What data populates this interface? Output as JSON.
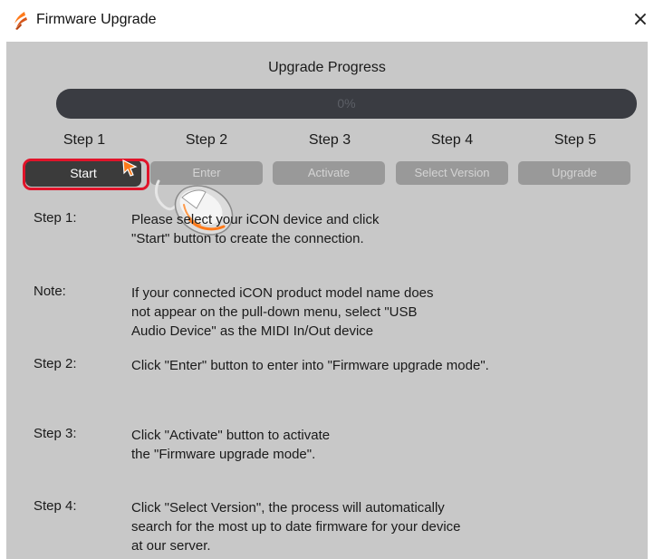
{
  "window": {
    "title": "Firmware Upgrade",
    "app_icon": "orange-swoosh-icon",
    "close_symbol": "×",
    "close_icon": "close-icon"
  },
  "progress": {
    "heading": "Upgrade Progress",
    "percent_label": "0%",
    "value": 0
  },
  "steps": [
    {
      "label": "Step 1",
      "button": "Start",
      "state": "active"
    },
    {
      "label": "Step 2",
      "button": "Enter",
      "state": "disabled"
    },
    {
      "label": "Step 3",
      "button": "Activate",
      "state": "disabled"
    },
    {
      "label": "Step 4",
      "button": "Select Version",
      "state": "disabled"
    },
    {
      "label": "Step 5",
      "button": "Upgrade",
      "state": "disabled"
    }
  ],
  "instructions": [
    {
      "label": "Step 1:",
      "text": "Please select your iCON device and click\n\"Start\" button to create the connection."
    },
    {
      "label": "Note:",
      "text": "If your connected iCON product model name does\nnot appear on the pull-down menu, select \"USB\nAudio Device\" as the MIDI In/Out device"
    },
    {
      "label": "Step 2:",
      "text": "Click \"Enter\" button to enter into \"Firmware upgrade mode\"."
    },
    {
      "label": "Step 3:",
      "text": "Click \"Activate\" button to activate\nthe \"Firmware upgrade mode\"."
    },
    {
      "label": "Step 4:",
      "text": "Click \"Select Version\", the process will automatically\nsearch for the most up to date firmware for your device\nat our server."
    }
  ],
  "colors": {
    "panel": "#c8c8c8",
    "progress_track": "#3a3c42",
    "active_button": "#3b3b3b",
    "disabled_button": "#999999",
    "highlight": "#e0142a",
    "accent": "#ff7a1a"
  }
}
